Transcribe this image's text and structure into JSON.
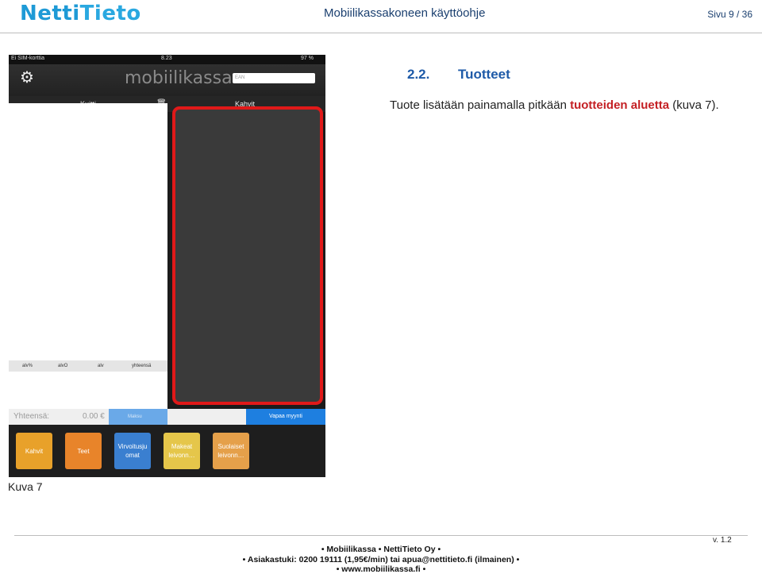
{
  "header": {
    "logo_part1": "Netti",
    "logo_part2": "Tieto",
    "title": "Mobiilikassakoneen käyttöohje",
    "page": "Sivu 9 / 36"
  },
  "screenshot": {
    "status_carrier": "Ei SIM-korttia",
    "status_time": "8.23",
    "status_battery": "97 %",
    "brand": "mobiilikassa",
    "ean_placeholder": "EAN",
    "left_tab": "Kuitti",
    "right_tab": "Kahvit",
    "tax_cols": [
      "alv%",
      "alvO",
      "alv",
      "yhteensä"
    ],
    "total_label": "Yhteensä:",
    "total_value": "0.00 €",
    "pay_button": "Maksu",
    "free_sale_button": "Vapaa myynti",
    "categories": [
      {
        "label": "Kahvit",
        "color": "#e8a12a"
      },
      {
        "label": "Teet",
        "color": "#e8842a"
      },
      {
        "label": "Virvoitusju omat",
        "color": "#3a7fd0"
      },
      {
        "label": "Makeat leivonn…",
        "color": "#e5c64a"
      },
      {
        "label": "Suolaiset leivonn…",
        "color": "#e5a04a"
      }
    ],
    "highlight_color": "#e01919"
  },
  "caption": "Kuva 7",
  "section": {
    "number": "2.2.",
    "title": "Tuotteet"
  },
  "paragraph": {
    "before": "Tuote lisätään painamalla pitkään ",
    "highlight": "tuotteiden aluetta",
    "after": " (kuva 7)."
  },
  "footer": {
    "version": "v. 1.2",
    "line1": "•  Mobiilikassa  •  NettiTieto Oy  •",
    "line2": "•  Asiakastuki: 0200 19111 (1,95€/min)  tai  apua@nettitieto.fi (ilmainen)  •",
    "line3": "•  www.mobiilikassa.fi  •"
  }
}
